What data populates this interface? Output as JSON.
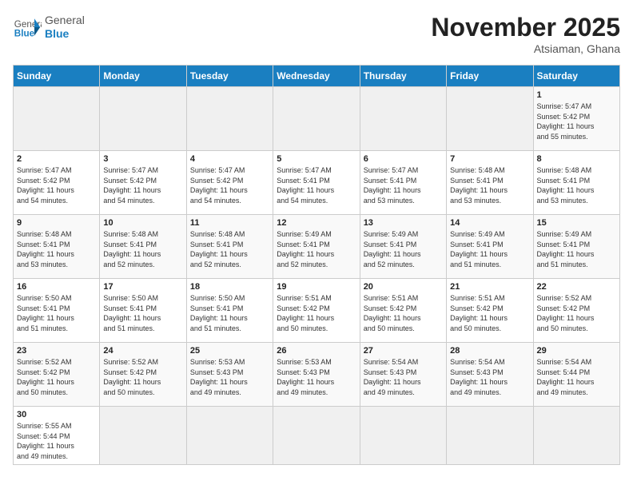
{
  "logo": {
    "general": "General",
    "blue": "Blue"
  },
  "header": {
    "month": "November 2025",
    "location": "Atsiaman, Ghana"
  },
  "days_of_week": [
    "Sunday",
    "Monday",
    "Tuesday",
    "Wednesday",
    "Thursday",
    "Friday",
    "Saturday"
  ],
  "weeks": [
    [
      {
        "day": "",
        "info": ""
      },
      {
        "day": "",
        "info": ""
      },
      {
        "day": "",
        "info": ""
      },
      {
        "day": "",
        "info": ""
      },
      {
        "day": "",
        "info": ""
      },
      {
        "day": "",
        "info": ""
      },
      {
        "day": "1",
        "info": "Sunrise: 5:47 AM\nSunset: 5:42 PM\nDaylight: 11 hours\nand 55 minutes."
      }
    ],
    [
      {
        "day": "2",
        "info": "Sunrise: 5:47 AM\nSunset: 5:42 PM\nDaylight: 11 hours\nand 54 minutes."
      },
      {
        "day": "3",
        "info": "Sunrise: 5:47 AM\nSunset: 5:42 PM\nDaylight: 11 hours\nand 54 minutes."
      },
      {
        "day": "4",
        "info": "Sunrise: 5:47 AM\nSunset: 5:42 PM\nDaylight: 11 hours\nand 54 minutes."
      },
      {
        "day": "5",
        "info": "Sunrise: 5:47 AM\nSunset: 5:41 PM\nDaylight: 11 hours\nand 54 minutes."
      },
      {
        "day": "6",
        "info": "Sunrise: 5:47 AM\nSunset: 5:41 PM\nDaylight: 11 hours\nand 53 minutes."
      },
      {
        "day": "7",
        "info": "Sunrise: 5:48 AM\nSunset: 5:41 PM\nDaylight: 11 hours\nand 53 minutes."
      },
      {
        "day": "8",
        "info": "Sunrise: 5:48 AM\nSunset: 5:41 PM\nDaylight: 11 hours\nand 53 minutes."
      }
    ],
    [
      {
        "day": "9",
        "info": "Sunrise: 5:48 AM\nSunset: 5:41 PM\nDaylight: 11 hours\nand 53 minutes."
      },
      {
        "day": "10",
        "info": "Sunrise: 5:48 AM\nSunset: 5:41 PM\nDaylight: 11 hours\nand 52 minutes."
      },
      {
        "day": "11",
        "info": "Sunrise: 5:48 AM\nSunset: 5:41 PM\nDaylight: 11 hours\nand 52 minutes."
      },
      {
        "day": "12",
        "info": "Sunrise: 5:49 AM\nSunset: 5:41 PM\nDaylight: 11 hours\nand 52 minutes."
      },
      {
        "day": "13",
        "info": "Sunrise: 5:49 AM\nSunset: 5:41 PM\nDaylight: 11 hours\nand 52 minutes."
      },
      {
        "day": "14",
        "info": "Sunrise: 5:49 AM\nSunset: 5:41 PM\nDaylight: 11 hours\nand 51 minutes."
      },
      {
        "day": "15",
        "info": "Sunrise: 5:49 AM\nSunset: 5:41 PM\nDaylight: 11 hours\nand 51 minutes."
      }
    ],
    [
      {
        "day": "16",
        "info": "Sunrise: 5:50 AM\nSunset: 5:41 PM\nDaylight: 11 hours\nand 51 minutes."
      },
      {
        "day": "17",
        "info": "Sunrise: 5:50 AM\nSunset: 5:41 PM\nDaylight: 11 hours\nand 51 minutes."
      },
      {
        "day": "18",
        "info": "Sunrise: 5:50 AM\nSunset: 5:41 PM\nDaylight: 11 hours\nand 51 minutes."
      },
      {
        "day": "19",
        "info": "Sunrise: 5:51 AM\nSunset: 5:42 PM\nDaylight: 11 hours\nand 50 minutes."
      },
      {
        "day": "20",
        "info": "Sunrise: 5:51 AM\nSunset: 5:42 PM\nDaylight: 11 hours\nand 50 minutes."
      },
      {
        "day": "21",
        "info": "Sunrise: 5:51 AM\nSunset: 5:42 PM\nDaylight: 11 hours\nand 50 minutes."
      },
      {
        "day": "22",
        "info": "Sunrise: 5:52 AM\nSunset: 5:42 PM\nDaylight: 11 hours\nand 50 minutes."
      }
    ],
    [
      {
        "day": "23",
        "info": "Sunrise: 5:52 AM\nSunset: 5:42 PM\nDaylight: 11 hours\nand 50 minutes."
      },
      {
        "day": "24",
        "info": "Sunrise: 5:52 AM\nSunset: 5:42 PM\nDaylight: 11 hours\nand 50 minutes."
      },
      {
        "day": "25",
        "info": "Sunrise: 5:53 AM\nSunset: 5:43 PM\nDaylight: 11 hours\nand 49 minutes."
      },
      {
        "day": "26",
        "info": "Sunrise: 5:53 AM\nSunset: 5:43 PM\nDaylight: 11 hours\nand 49 minutes."
      },
      {
        "day": "27",
        "info": "Sunrise: 5:54 AM\nSunset: 5:43 PM\nDaylight: 11 hours\nand 49 minutes."
      },
      {
        "day": "28",
        "info": "Sunrise: 5:54 AM\nSunset: 5:43 PM\nDaylight: 11 hours\nand 49 minutes."
      },
      {
        "day": "29",
        "info": "Sunrise: 5:54 AM\nSunset: 5:44 PM\nDaylight: 11 hours\nand 49 minutes."
      }
    ],
    [
      {
        "day": "30",
        "info": "Sunrise: 5:55 AM\nSunset: 5:44 PM\nDaylight: 11 hours\nand 49 minutes."
      },
      {
        "day": "",
        "info": ""
      },
      {
        "day": "",
        "info": ""
      },
      {
        "day": "",
        "info": ""
      },
      {
        "day": "",
        "info": ""
      },
      {
        "day": "",
        "info": ""
      },
      {
        "day": "",
        "info": ""
      }
    ]
  ]
}
